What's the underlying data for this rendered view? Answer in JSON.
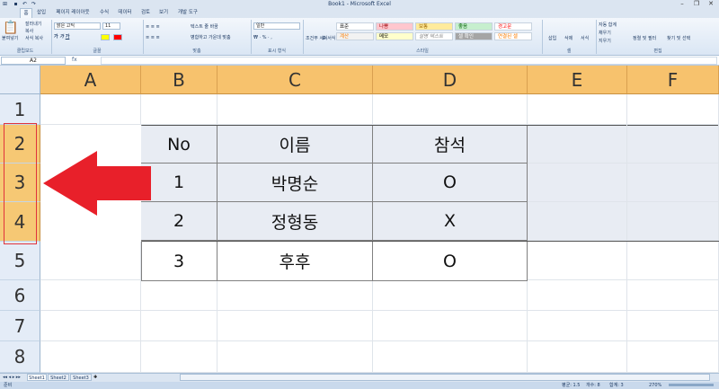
{
  "window": {
    "title": "Book1 - Microsoft Excel",
    "controls": [
      "–",
      "❐",
      "✕"
    ]
  },
  "tabs": [
    "홈",
    "삽입",
    "페이지 레이아웃",
    "수식",
    "데이터",
    "검토",
    "보기",
    "개발 도구"
  ],
  "ribbon": {
    "clipboard": {
      "paste": "붙여넣기",
      "cut": "잘라내기",
      "copy": "복사",
      "format_painter": "서식 복사",
      "group": "클립보드"
    },
    "font": {
      "name": "맑은 고딕",
      "size": "11",
      "group": "글꼴"
    },
    "alignment": {
      "wrap": "텍스트 줄 바꿈",
      "merge": "병합하고 가운데 맞춤",
      "group": "맞춤"
    },
    "number": {
      "format": "일반",
      "group": "표시 형식"
    },
    "styles": {
      "conditional": "조건부 서식",
      "table": "표 서식",
      "cells": [
        {
          "label": "표준",
          "bg": "#ffffff",
          "color": "#000000"
        },
        {
          "label": "나쁨",
          "bg": "#ffc7ce",
          "color": "#9c0006"
        },
        {
          "label": "보통",
          "bg": "#ffeb9c",
          "color": "#9c6500"
        },
        {
          "label": "좋음",
          "bg": "#c6efce",
          "color": "#006100"
        },
        {
          "label": "경고문",
          "bg": "#ffffff",
          "color": "#ff0000"
        },
        {
          "label": "계산",
          "bg": "#f2f2f2",
          "color": "#fa7d00"
        },
        {
          "label": "메모",
          "bg": "#ffffcc",
          "color": "#000000"
        },
        {
          "label": "설명 텍스트",
          "bg": "#ffffff",
          "color": "#7f7f7f"
        },
        {
          "label": "셀 확인",
          "bg": "#a5a5a5",
          "color": "#ffffff"
        },
        {
          "label": "연결된 셀",
          "bg": "#ffffff",
          "color": "#fa7d00"
        }
      ],
      "group": "스타일"
    },
    "cells_group": {
      "insert": "삽입",
      "delete": "삭제",
      "format": "서식",
      "group": "셀"
    },
    "editing": {
      "autosum": "자동 합계",
      "fill": "채우기",
      "clear": "지우기",
      "sort": "정렬 및 필터",
      "find": "찾기 및 선택",
      "group": "편집"
    }
  },
  "formula_bar": {
    "name_box": "A2",
    "fx": "fx",
    "value": ""
  },
  "columns": [
    "A",
    "B",
    "C",
    "D",
    "E",
    "F"
  ],
  "rows": [
    "1",
    "2",
    "3",
    "4",
    "5",
    "6",
    "7",
    "8"
  ],
  "table": {
    "header": [
      "No",
      "이름",
      "참석"
    ],
    "rows": [
      [
        "1",
        "박명순",
        "O"
      ],
      [
        "2",
        "정형동",
        "X"
      ],
      [
        "3",
        "후후",
        "O"
      ]
    ]
  },
  "sheets": [
    "Sheet1",
    "Sheet2",
    "Sheet3"
  ],
  "status": {
    "ready": "준비",
    "average": "평균: 1.5",
    "count": "개수: 8",
    "sum": "합계: 3",
    "zoom": "270%"
  },
  "colors": {
    "arrow": "#e8202a",
    "highlight_box": "#e0323c",
    "column_header": "#f7c26d"
  }
}
